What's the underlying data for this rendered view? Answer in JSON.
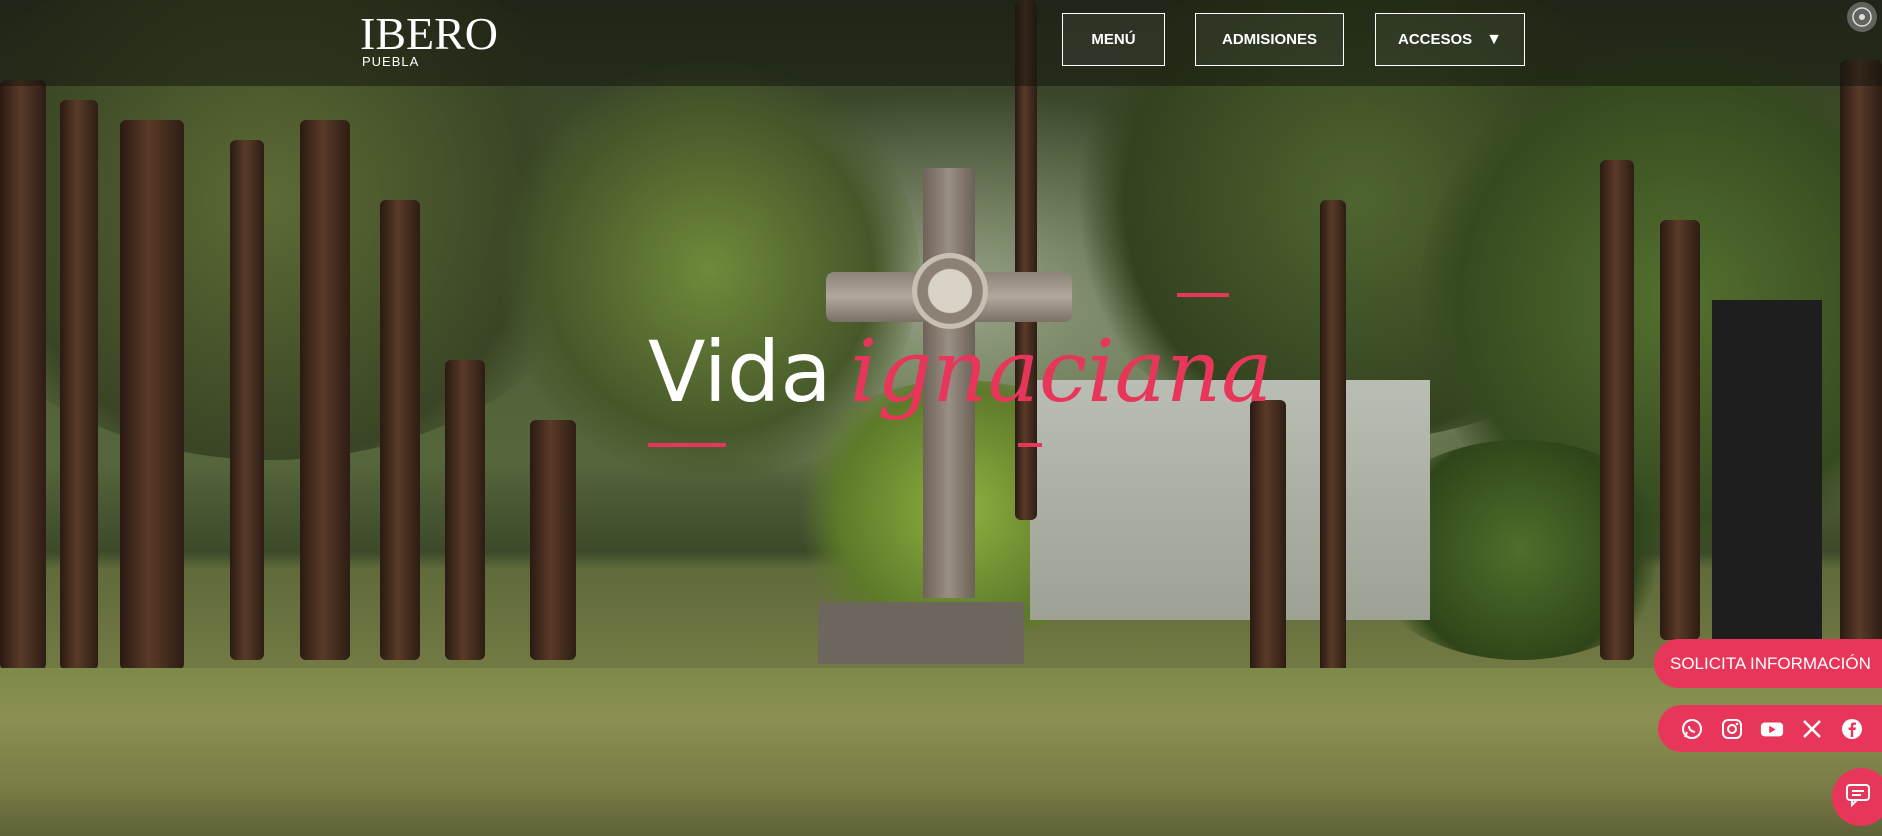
{
  "header": {
    "logo_text": "IBERO",
    "logo_sub": "PUEBLA",
    "nav": {
      "menu_label": "MENÚ",
      "admisiones_label": "ADMISIONES",
      "accesos_label": "ACCESOS",
      "accesos_caret": "▼"
    }
  },
  "hero": {
    "title_word1": "Vida",
    "title_word2": "ignaciana"
  },
  "floating": {
    "solicita_label": "SOLICITA INFORMACIÓN",
    "social_icons": [
      "whatsapp-icon",
      "instagram-icon",
      "youtube-icon",
      "x-icon",
      "facebook-icon"
    ],
    "chat_icon": "chat-icon"
  },
  "colors": {
    "accent": "#e8365b",
    "header_text": "#ffffff"
  }
}
